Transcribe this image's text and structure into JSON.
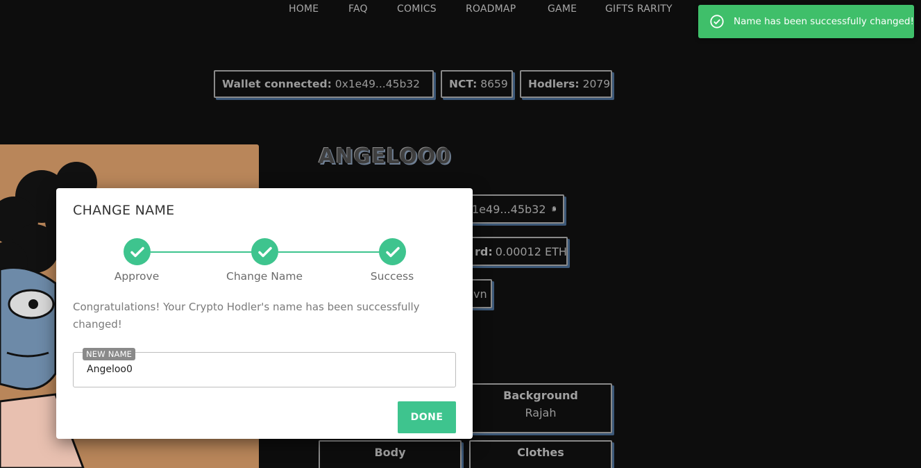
{
  "nav": {
    "items": [
      "HOME",
      "FAQ",
      "COMICS",
      "ROADMAP",
      "GAME",
      "GIFTS RARITY"
    ]
  },
  "toast": {
    "message": "Name has been successfully changed!",
    "icon": "check-circle-icon",
    "color": "#3fbf6a"
  },
  "header_pills": {
    "wallet_label": "Wallet connected:",
    "wallet_value": "0x1e49...45b32",
    "nct_label": "NCT:",
    "nct_value": "8659",
    "hodlers_label": "Hodlers:",
    "hodlers_value": "2079"
  },
  "hodler": {
    "name": "ANGELOO0",
    "owner_value": "1e49...45b32",
    "reward_label": "rd:",
    "reward_value": "0.00012 ETH",
    "partial_text": "vn"
  },
  "traits": [
    {
      "title": "Background",
      "value": "Rajah"
    },
    {
      "title": "Body",
      "value": ""
    },
    {
      "title": "Clothes",
      "value": ""
    }
  ],
  "modal": {
    "title": "CHANGE NAME",
    "steps": [
      "Approve",
      "Change Name",
      "Success"
    ],
    "message": "Congratulations! Your Crypto Hodler's name has been successfully changed!",
    "field_label": "NEW NAME",
    "field_value": "Angeloo0",
    "done_label": "DONE",
    "accent": "#3ec48e"
  }
}
